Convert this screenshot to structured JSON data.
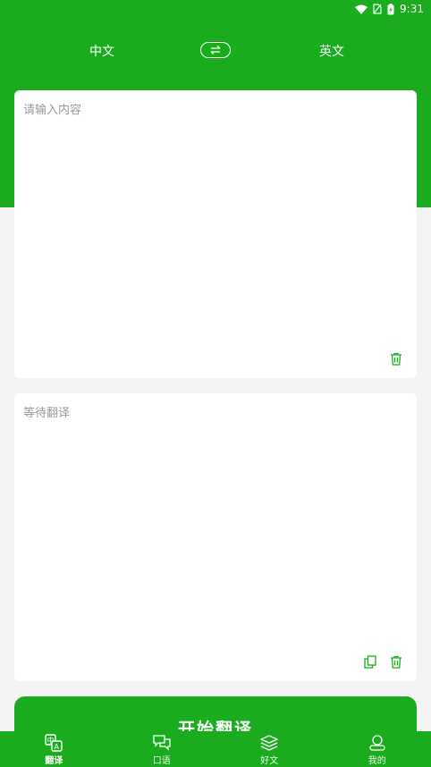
{
  "status_bar": {
    "time": "9:31"
  },
  "header": {
    "source_lang": "中文",
    "target_lang": "英文"
  },
  "input_card": {
    "placeholder": "请输入内容"
  },
  "output_card": {
    "placeholder": "等待翻译"
  },
  "translate_button": {
    "label": "开始翻译"
  },
  "tabs": [
    {
      "label": "翻译",
      "icon": "translate-icon",
      "active": true
    },
    {
      "label": "口语",
      "icon": "chat-icon",
      "active": false
    },
    {
      "label": "好文",
      "icon": "stack-icon",
      "active": false
    },
    {
      "label": "我的",
      "icon": "user-icon",
      "active": false
    }
  ],
  "colors": {
    "primary": "#1aac1e",
    "background": "#f4f4f4",
    "placeholder": "#999999"
  }
}
